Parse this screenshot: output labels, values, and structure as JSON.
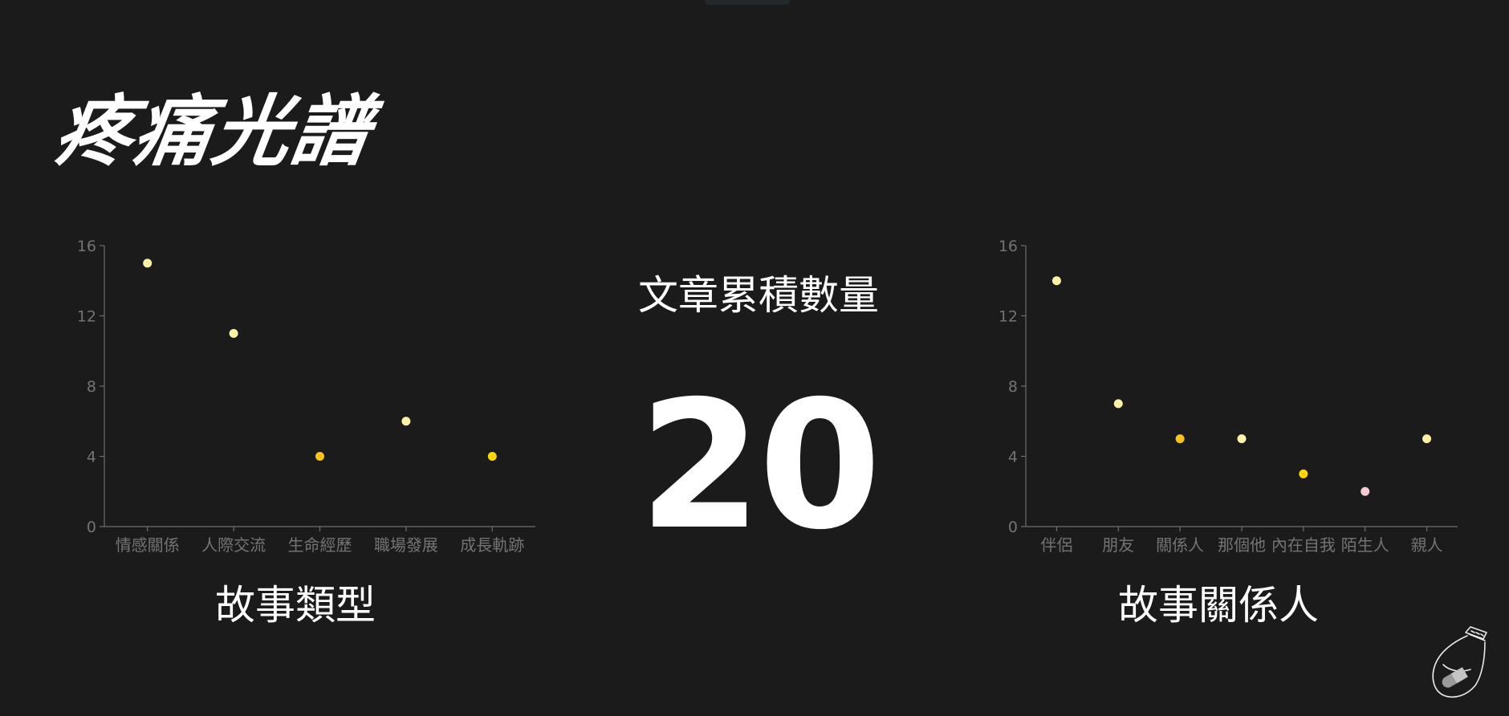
{
  "title": "疼痛光譜",
  "counter": {
    "label": "文章累積數量",
    "value": "20"
  },
  "colors": {
    "background": "#1b1b1b",
    "axis": "#6e6e6e",
    "tick_text": "#737373",
    "light_yellow": "#fff2a8",
    "gold": "#ffc21a",
    "yellow": "#ffd60a",
    "pink": "#f6c9d3"
  },
  "icons": [
    "jar-icon"
  ],
  "chart_data": [
    {
      "type": "scatter",
      "caption": "故事類型",
      "categories": [
        "情感關係",
        "人際交流",
        "生命經歷",
        "職場發展",
        "成長軌跡"
      ],
      "values": [
        15,
        11,
        4,
        6,
        4
      ],
      "point_colors": [
        "#fff2a8",
        "#fff2a8",
        "#ffc21a",
        "#fff2a8",
        "#ffd60a"
      ],
      "ylim": [
        0,
        16
      ],
      "yticks": [
        0,
        4,
        8,
        12,
        16
      ],
      "grid": false,
      "legend": "none"
    },
    {
      "type": "scatter",
      "caption": "故事關係人",
      "categories": [
        "伴侶",
        "朋友",
        "關係人",
        "那個他",
        "內在自我",
        "陌生人",
        "親人"
      ],
      "values": [
        14,
        7,
        5,
        5,
        3,
        2,
        5
      ],
      "point_colors": [
        "#fff2a8",
        "#fff2a8",
        "#ffc21a",
        "#fff2a8",
        "#ffd60a",
        "#f6c9d3",
        "#fff2a8"
      ],
      "ylim": [
        0,
        16
      ],
      "yticks": [
        0,
        4,
        8,
        12,
        16
      ],
      "grid": false,
      "legend": "none"
    }
  ]
}
